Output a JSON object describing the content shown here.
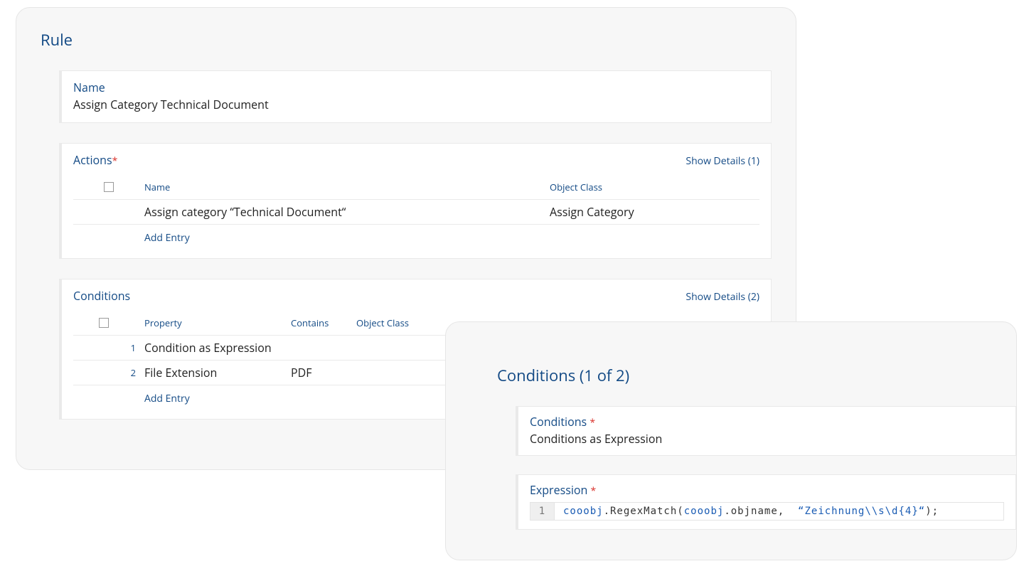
{
  "rule": {
    "title": "Rule",
    "name_label": "Name",
    "name_value": "Assign Category Technical Document"
  },
  "actions": {
    "title": "Actions",
    "required_mark": "*",
    "show_details": "Show Details (1)",
    "columns": {
      "name": "Name",
      "object_class": "Object Class"
    },
    "rows": [
      {
        "name": "Assign category “Technical Document“",
        "object_class": "Assign Category"
      }
    ],
    "add_entry": "Add Entry"
  },
  "conditions": {
    "title": "Conditions",
    "show_details": "Show Details (2)",
    "columns": {
      "property": "Property",
      "contains": "Contains",
      "object_class": "Object Class"
    },
    "rows": [
      {
        "idx": "1",
        "property": "Condition as Expression",
        "contains": "",
        "object_class": ""
      },
      {
        "idx": "2",
        "property": "File Extension",
        "contains": "PDF",
        "object_class": ""
      }
    ],
    "add_entry": "Add Entry"
  },
  "cond_detail": {
    "title": "Conditions (1 of 2)",
    "conditions_label": "Conditions ",
    "conditions_required": "*",
    "conditions_value": "Conditions as Expression",
    "expression_label": "Expression ",
    "expression_required": "*",
    "expr_gutter": "1",
    "expr_tokens": {
      "a": "cooobj",
      "b": ".RegexMatch(",
      "c": "cooobj",
      "d": ".objname,  ",
      "e": "“Zeichnung\\\\s\\d{4}“",
      "f": ");"
    }
  }
}
